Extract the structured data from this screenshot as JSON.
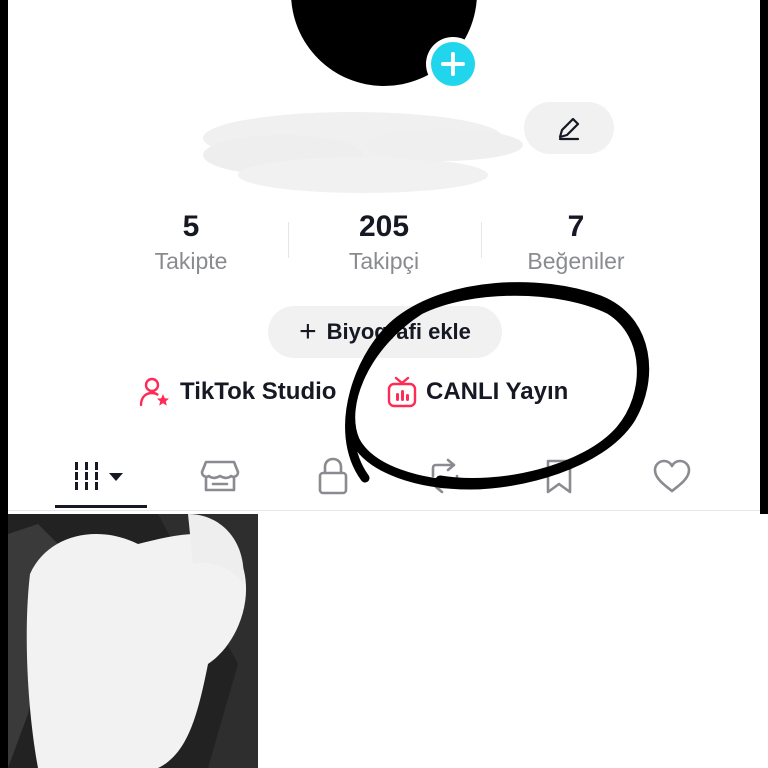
{
  "profile": {
    "add_button_symbol": "+",
    "edit_icon": "pencil-icon"
  },
  "stats": [
    {
      "value": "5",
      "label": "Takipte"
    },
    {
      "value": "205",
      "label": "Takipçi"
    },
    {
      "value": "7",
      "label": "Beğeniler"
    }
  ],
  "bio_button": {
    "plus": "+",
    "label": "Biyografi ekle"
  },
  "links": {
    "studio": {
      "label": "TikTok Studio",
      "icon": "person-star-icon"
    },
    "live": {
      "label": "CANLI Yayın",
      "icon": "live-tv-icon"
    }
  },
  "tabs": [
    {
      "name": "grid-menu-icon",
      "active": true
    },
    {
      "name": "shop-icon",
      "active": false
    },
    {
      "name": "lock-icon",
      "active": false
    },
    {
      "name": "repost-icon",
      "active": false
    },
    {
      "name": "bookmark-icon",
      "active": false
    },
    {
      "name": "heart-icon",
      "active": false
    }
  ],
  "colors": {
    "accent_cyan": "#20d5ec",
    "accent_pink": "#fe2c55",
    "text_primary": "#161823",
    "text_secondary": "#8a8b91",
    "chip_bg": "#f1f1f2"
  }
}
